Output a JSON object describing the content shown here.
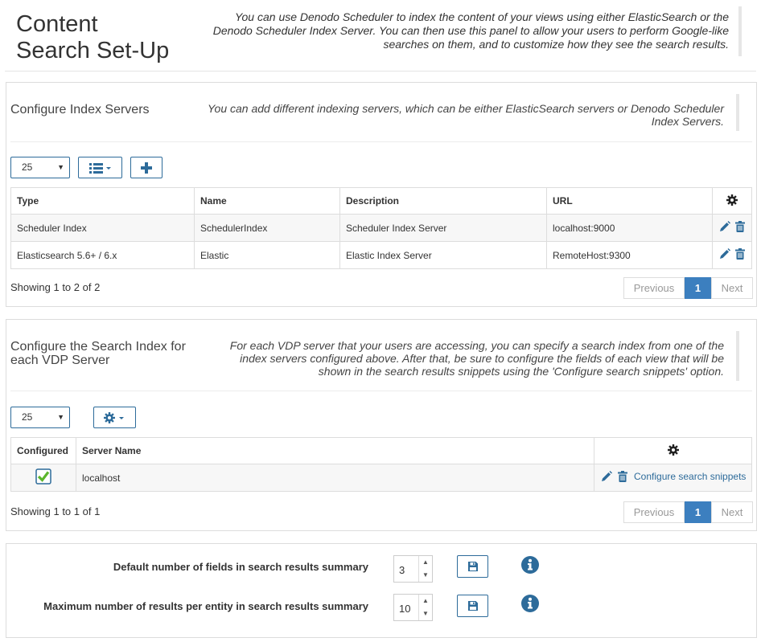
{
  "header": {
    "title_line1": "Content",
    "title_line2": "Search Set-Up",
    "description": "You can use Denodo Scheduler to index the content of your views using either ElasticSearch or the Denodo Scheduler Index Server. You can then use this panel to allow your users to perform Google-like searches on them, and to customize how they see the search results."
  },
  "index_servers": {
    "title": "Configure Index Servers",
    "description": "You can add different indexing servers, which can be either ElasticSearch servers or Denodo Scheduler Index Servers.",
    "page_size": "25",
    "columns": [
      "Type",
      "Name",
      "Description",
      "URL"
    ],
    "rows": [
      {
        "type": "Scheduler Index",
        "name": "SchedulerIndex",
        "description": "Scheduler Index Server",
        "url": "localhost:9000"
      },
      {
        "type": "Elasticsearch 5.6+ / 6.x",
        "name": "Elastic",
        "description": "Elastic Index Server",
        "url": "RemoteHost:9300"
      }
    ],
    "showing": "Showing 1 to 2 of 2",
    "pager": {
      "previous": "Previous",
      "page": "1",
      "next": "Next"
    }
  },
  "search_index": {
    "title": "Configure the Search Index for each VDP Server",
    "description": "For each VDP server that your users are accessing, you can specify a search index from one of the index servers configured above. After that, be sure to configure the fields of each view that will be shown in the search results snippets using the 'Configure search snippets' option.",
    "page_size": "25",
    "columns": [
      "Configured",
      "Server Name"
    ],
    "rows": [
      {
        "configured": true,
        "server_name": "localhost",
        "action_label": "Configure search snippets"
      }
    ],
    "showing": "Showing 1 to 1 of 1",
    "pager": {
      "previous": "Previous",
      "page": "1",
      "next": "Next"
    }
  },
  "settings": {
    "default_fields_label": "Default number of fields in search results summary",
    "default_fields_value": "3",
    "max_results_label": "Maximum number of results per entity in search results summary",
    "max_results_value": "10"
  },
  "colors": {
    "accent": "#2d6b9a",
    "active_page": "#3c7fbf",
    "check": "#5bb52c"
  }
}
